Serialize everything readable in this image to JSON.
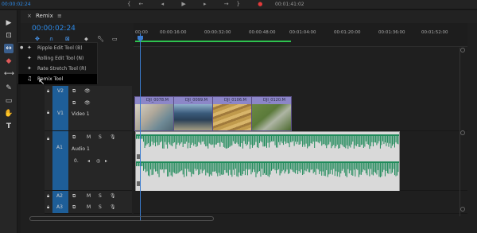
{
  "topbar": {
    "left_timecode": "00:00:02:24",
    "right_timecode": "00:01:41:02",
    "transport": [
      "{←",
      "◂",
      "▶",
      "▸",
      "→}",
      "⊞"
    ]
  },
  "tools": [
    {
      "name": "selection",
      "glyph": "▶"
    },
    {
      "name": "track-select",
      "glyph": "⊡"
    },
    {
      "name": "ripple-edit",
      "glyph": "↔"
    },
    {
      "name": "razor",
      "glyph": "◆"
    },
    {
      "name": "slip",
      "glyph": "⟷"
    },
    {
      "name": "pen",
      "glyph": "✎"
    },
    {
      "name": "rectangle",
      "glyph": "▭"
    },
    {
      "name": "hand",
      "glyph": "✋"
    },
    {
      "name": "type",
      "glyph": "T"
    }
  ],
  "timeline": {
    "tab_label": "Remix",
    "menu_glyph": "≡",
    "close_glyph": "×",
    "timecode": "00:00:02:24",
    "ruler_ticks": [
      "00:00",
      "00:00:16:00",
      "00:00:32:00",
      "00:00:48:00",
      "00:01:04:00",
      "00:01:20:00",
      "00:01:36:00",
      "00:01:52:00"
    ]
  },
  "menu": {
    "items": [
      {
        "label": "Ripple Edit Tool (B)",
        "glyph": "✦"
      },
      {
        "label": "Rolling Edit Tool (N)",
        "glyph": "✦"
      },
      {
        "label": "Rate Stretch Tool (R)",
        "glyph": "✦"
      },
      {
        "label": "Remix Tool",
        "glyph": "♫"
      }
    ]
  },
  "tracks": {
    "v2": "V2",
    "v1": "V1",
    "v1_name": "Video 1",
    "a1": "A1",
    "a1_name": "Audio 1",
    "a2": "A2",
    "a3": "A3",
    "m": "M",
    "s": "S",
    "vol_value": "0."
  },
  "clips": [
    {
      "name": "DJI_0078.M",
      "colors": [
        "#c8c2b4",
        "#6f8a96"
      ]
    },
    {
      "name": "DJI_0099.M",
      "colors": [
        "#3a5a7a",
        "#a69f83"
      ]
    },
    {
      "name": "DJI_0106.M",
      "colors": [
        "#c09a4c",
        "#8a6a3a"
      ]
    },
    {
      "name": "DJI_0120.M",
      "colors": [
        "#5b7a3a",
        "#aeb5a4"
      ]
    }
  ],
  "colors": {
    "accent": "#2d8ceb",
    "track_label": "#1e5e98",
    "clip": "#8c86c8",
    "wave": "#1f8a5a",
    "work_area": "#2ec24f"
  }
}
